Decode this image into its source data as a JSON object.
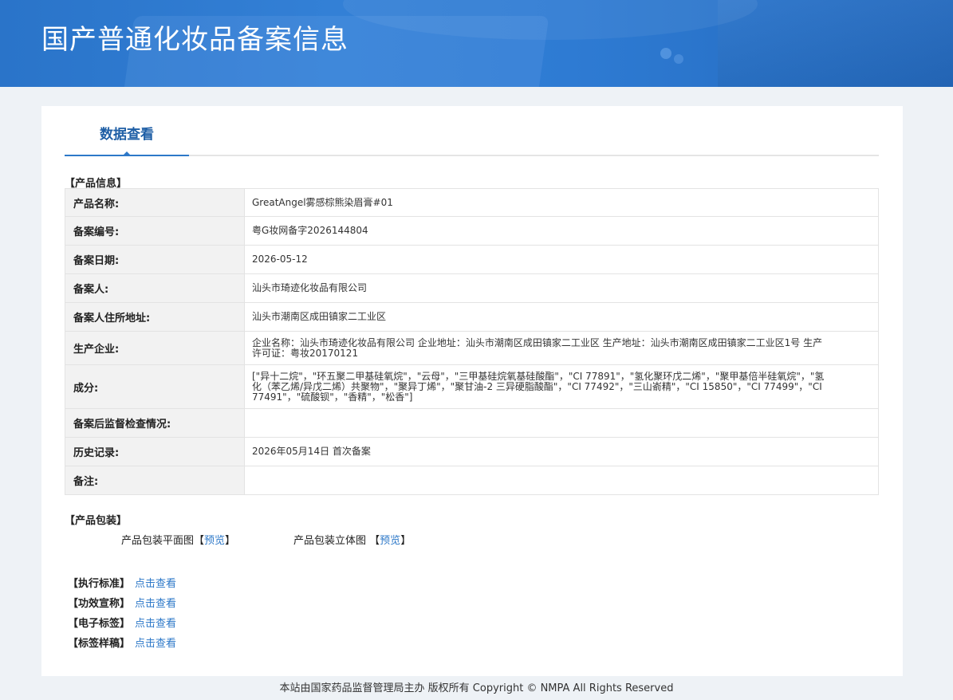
{
  "header": {
    "title": "国产普通化妆品备案信息"
  },
  "tab": {
    "label": "数据查看"
  },
  "product_info": {
    "section_title": "【产品信息】",
    "rows": [
      {
        "label": "产品名称:",
        "value": "GreatAngel雾感棕熊染眉膏#01"
      },
      {
        "label": "备案编号:",
        "value": "粤G妆网备字2026144804"
      },
      {
        "label": "备案日期:",
        "value": "2026-05-12"
      },
      {
        "label": "备案人:",
        "value": "汕头市琦迹化妆品有限公司"
      },
      {
        "label": "备案人住所地址:",
        "value": "汕头市潮南区成田镇家二工业区"
      },
      {
        "label": "生产企业:",
        "value": "企业名称：汕头市琦迹化妆品有限公司 企业地址：汕头市潮南区成田镇家二工业区 生产地址：汕头市潮南区成田镇家二工业区1号 生产许可证：粤妆20170121"
      },
      {
        "label": "成分:",
        "value": "[\"异十二烷\"，\"环五聚二甲基硅氧烷\"，\"云母\"，\"三甲基硅烷氧基硅酸酯\"，\"CI 77891\"，\"氢化聚环戊二烯\"，\"聚甲基倍半硅氧烷\"，\"氢化（苯乙烯/异戊二烯）共聚物\"，\"聚异丁烯\"，\"聚甘油-2 三异硬脂酸酯\"，\"CI 77492\"，\"三山嵛精\"，\"CI 15850\"，\"CI 77499\"，\"CI 77491\"，\"硫酸钡\"，\"香精\"，\"松香\"]"
      },
      {
        "label": "备案后监督检查情况:",
        "value": ""
      },
      {
        "label": "历史记录:",
        "value": "2026年05月14日 首次备案"
      },
      {
        "label": "备注:",
        "value": ""
      }
    ]
  },
  "packaging": {
    "section_title": "【产品包装】",
    "flat_label": "产品包装平面图",
    "solid_label": "产品包装立体图",
    "preview_link": "预览",
    "bracket_open": "【",
    "bracket_close": "】"
  },
  "links": [
    {
      "label": "【执行标准】",
      "link": "点击查看"
    },
    {
      "label": "【功效宣称】",
      "link": "点击查看"
    },
    {
      "label": "【电子标签】",
      "link": "点击查看"
    },
    {
      "label": "【标签样稿】",
      "link": "点击查看"
    }
  ],
  "footer": {
    "text": "本站由国家药品监督管理局主办 版权所有 Copyright © NMPA All Rights Reserved"
  },
  "colors": {
    "banner": "#2e7bd3",
    "link": "#2d78c8",
    "tab": "#1f5fa6"
  }
}
